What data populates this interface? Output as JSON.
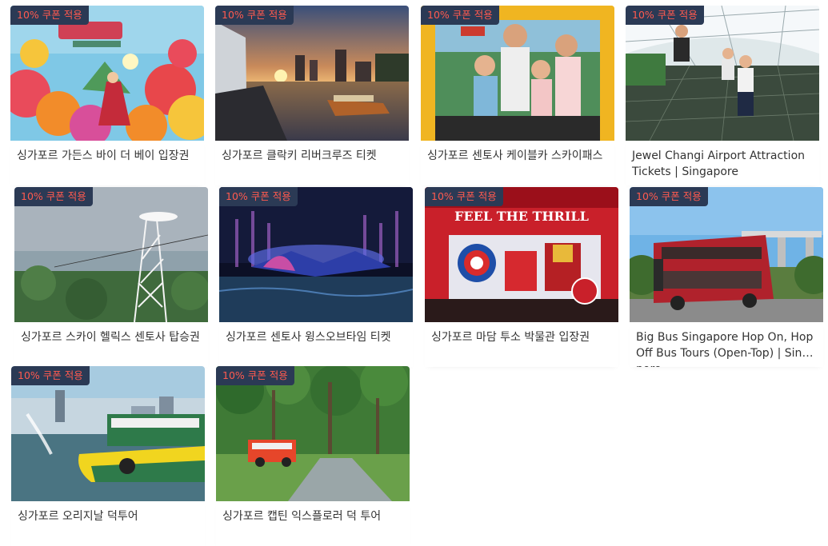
{
  "badge_text": "10% 쿠폰 적용",
  "cards": [
    {
      "title": "싱가포르 가든스 바이 더 베이 입장권",
      "image": "gardens-by-the-bay-festival"
    },
    {
      "title": "싱가포르 클락키 리버크루즈 티켓",
      "image": "clarke-quay-river-cruise-sunset"
    },
    {
      "title": "싱가포르 센토사 케이블카 스카이패스",
      "image": "sentosa-cable-car-family"
    },
    {
      "title": "Jewel Changi Airport Attraction Tickets | Singapore",
      "image": "jewel-canopy-net"
    },
    {
      "title": "싱가포르 스카이 헬릭스 센토사 탑승권",
      "image": "sky-helix-tower"
    },
    {
      "title": "싱가포르 센토사 윙스오브타임 티켓",
      "image": "wings-of-time-show"
    },
    {
      "title": "싱가포르 마담 투소 박물관 입장권",
      "image": "madame-tussauds-marvel-4d",
      "image_text": "FEEL THE THRILL"
    },
    {
      "title": "Big Bus Singapore Hop On, Hop Off Bus Tours (Open-Top) | Singapore",
      "image": "big-bus-red-double-decker"
    },
    {
      "title": "싱가포르 오리지날 덕투어",
      "image": "duck-tour-boat"
    },
    {
      "title": "싱가포르 캡틴 익스플로러 덕 투어",
      "image": "captain-explorer-duck-park"
    }
  ]
}
